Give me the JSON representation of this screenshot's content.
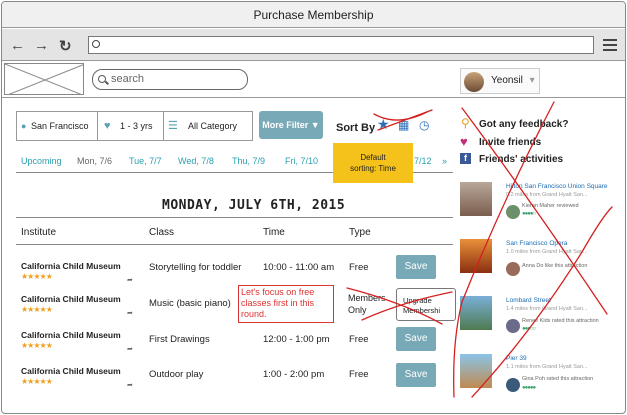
{
  "window": {
    "title": "Purchase Membership"
  },
  "browser": {
    "back_icon": "arrow-left-icon",
    "forward_icon": "arrow-right-icon",
    "reload_icon": "refresh-icon",
    "url_value": "",
    "menu_icon": "hamburger-icon"
  },
  "header": {
    "search_placeholder": "search",
    "user_name": "Yeonsil"
  },
  "filters": {
    "location": "San Francisco",
    "age": "1 - 3 yrs",
    "category": "All Category",
    "more_filter": "More Filter",
    "sort_by": "Sort By"
  },
  "dates": [
    "Upcoming",
    "Mon, 7/6",
    "Tue, 7/7",
    "Wed, 7/8",
    "Thu, 7/9",
    "Fri, 7/10",
    "7/12"
  ],
  "sticky_note": {
    "line1": "Default",
    "line2": "sorting: Time"
  },
  "day_heading": "MONDAY, JULY 6TH, 2015",
  "table": {
    "headers": [
      "Institute",
      "Class",
      "Time",
      "Type"
    ],
    "rows": [
      {
        "institute": "California Child Museum",
        "stars": "★★★★★",
        "class": "Storytelling for toddler",
        "time": "10:00 - 11:00 am",
        "type": "Free",
        "action": "Save"
      },
      {
        "institute": "California Child Museum",
        "stars": "★★★★★",
        "class": "Music (basic piano)",
        "time": "",
        "type": "Members Only",
        "action": "Upgrade Membershi"
      },
      {
        "institute": "California Child Museum",
        "stars": "★★★★★",
        "class": "First Drawings",
        "time": "12:00 - 1:00 pm",
        "type": "Free",
        "action": "Save"
      },
      {
        "institute": "California Child Museum",
        "stars": "★★★★★",
        "class": "Outdoor play",
        "time": "1:00 - 2:00 pm",
        "type": "Free",
        "action": "Save"
      }
    ]
  },
  "comment": "Let's focus on free classes first in this round.",
  "sidebar": {
    "feedback": "Got any feedback?",
    "invite": "Invite friends",
    "activities": "Friends' activities",
    "cards": [
      {
        "title": "Hilton San Francisco Union Square",
        "sub": "0.2 miles from Grand Hyatt San...",
        "activity": "Kieran Maher reviewed",
        "rating": "●●●●○"
      },
      {
        "title": "San Francisco Opera",
        "sub": "1.0 miles from Grand Hyatt San...",
        "activity": "Anna Do like this attraction",
        "rating": ""
      },
      {
        "title": "Lombard Street",
        "sub": "1.4 miles from Grand Hyatt San...",
        "activity": "Renee Kids rated this attraction",
        "rating": "●●●○○"
      },
      {
        "title": "Pier 39",
        "sub": "1.1 miles from Grand Hyatt San...",
        "activity": "Gina Poh rated this attraction",
        "rating": "●●●●●"
      }
    ]
  }
}
